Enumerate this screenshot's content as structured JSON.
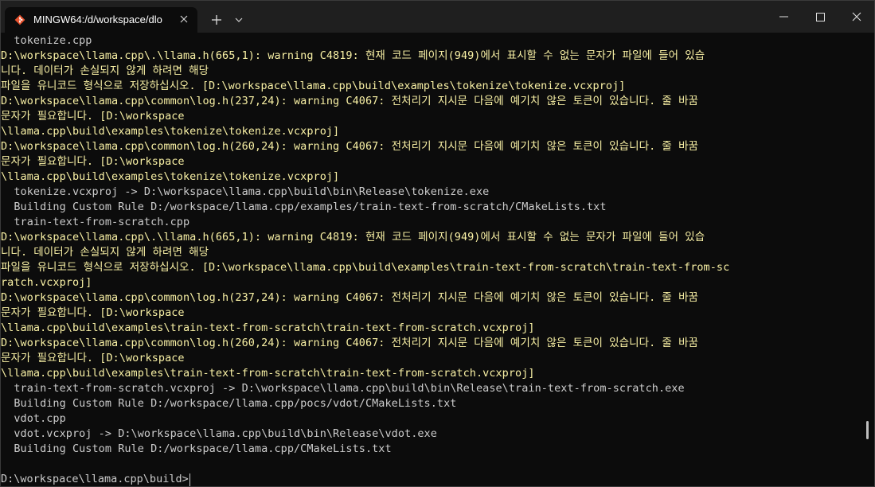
{
  "window": {
    "tab_title": "MINGW64:/d/workspace/dlo",
    "colors": {
      "warning": "#f9f1a5",
      "normal": "#cccccc",
      "background": "#0c0c0c",
      "titlebar": "#1f1f1f"
    }
  },
  "terminal": {
    "lines": [
      {
        "text": "  tokenize.cpp",
        "style": "gray"
      },
      {
        "text": "D:\\workspace\\llama.cpp\\.\\llama.h(665,1): warning C4819: 현재 코드 페이지(949)에서 표시할 수 없는 문자가 파일에 들어 있습",
        "style": "yellow"
      },
      {
        "text": "니다. 데이터가 손실되지 않게 하려면 해당",
        "style": "yellow"
      },
      {
        "text": "파일을 유니코드 형식으로 저장하십시오. [D:\\workspace\\llama.cpp\\build\\examples\\tokenize\\tokenize.vcxproj]",
        "style": "yellow"
      },
      {
        "text": "D:\\workspace\\llama.cpp\\common\\log.h(237,24): warning C4067: 전처리기 지시문 다음에 예기치 않은 토큰이 있습니다. 줄 바꿈",
        "style": "yellow"
      },
      {
        "text": "문자가 필요합니다. [D:\\workspace",
        "style": "yellow"
      },
      {
        "text": "\\llama.cpp\\build\\examples\\tokenize\\tokenize.vcxproj]",
        "style": "yellow"
      },
      {
        "text": "D:\\workspace\\llama.cpp\\common\\log.h(260,24): warning C4067: 전처리기 지시문 다음에 예기치 않은 토큰이 있습니다. 줄 바꿈",
        "style": "yellow"
      },
      {
        "text": "문자가 필요합니다. [D:\\workspace",
        "style": "yellow"
      },
      {
        "text": "\\llama.cpp\\build\\examples\\tokenize\\tokenize.vcxproj]",
        "style": "yellow"
      },
      {
        "text": "  tokenize.vcxproj -> D:\\workspace\\llama.cpp\\build\\bin\\Release\\tokenize.exe",
        "style": "gray"
      },
      {
        "text": "  Building Custom Rule D:/workspace/llama.cpp/examples/train-text-from-scratch/CMakeLists.txt",
        "style": "gray"
      },
      {
        "text": "  train-text-from-scratch.cpp",
        "style": "gray"
      },
      {
        "text": "D:\\workspace\\llama.cpp\\.\\llama.h(665,1): warning C4819: 현재 코드 페이지(949)에서 표시할 수 없는 문자가 파일에 들어 있습",
        "style": "yellow"
      },
      {
        "text": "니다. 데이터가 손실되지 않게 하려면 해당",
        "style": "yellow"
      },
      {
        "text": "파일을 유니코드 형식으로 저장하십시오. [D:\\workspace\\llama.cpp\\build\\examples\\train-text-from-scratch\\train-text-from-sc",
        "style": "yellow"
      },
      {
        "text": "ratch.vcxproj]",
        "style": "yellow"
      },
      {
        "text": "D:\\workspace\\llama.cpp\\common\\log.h(237,24): warning C4067: 전처리기 지시문 다음에 예기치 않은 토큰이 있습니다. 줄 바꿈",
        "style": "yellow"
      },
      {
        "text": "문자가 필요합니다. [D:\\workspace",
        "style": "yellow"
      },
      {
        "text": "\\llama.cpp\\build\\examples\\train-text-from-scratch\\train-text-from-scratch.vcxproj]",
        "style": "yellow"
      },
      {
        "text": "D:\\workspace\\llama.cpp\\common\\log.h(260,24): warning C4067: 전처리기 지시문 다음에 예기치 않은 토큰이 있습니다. 줄 바꿈",
        "style": "yellow"
      },
      {
        "text": "문자가 필요합니다. [D:\\workspace",
        "style": "yellow"
      },
      {
        "text": "\\llama.cpp\\build\\examples\\train-text-from-scratch\\train-text-from-scratch.vcxproj]",
        "style": "yellow"
      },
      {
        "text": "  train-text-from-scratch.vcxproj -> D:\\workspace\\llama.cpp\\build\\bin\\Release\\train-text-from-scratch.exe",
        "style": "gray"
      },
      {
        "text": "  Building Custom Rule D:/workspace/llama.cpp/pocs/vdot/CMakeLists.txt",
        "style": "gray"
      },
      {
        "text": "  vdot.cpp",
        "style": "gray"
      },
      {
        "text": "  vdot.vcxproj -> D:\\workspace\\llama.cpp\\build\\bin\\Release\\vdot.exe",
        "style": "gray"
      },
      {
        "text": "  Building Custom Rule D:/workspace/llama.cpp/CMakeLists.txt",
        "style": "gray"
      }
    ],
    "prompt": "D:\\workspace\\llama.cpp\\build>"
  }
}
